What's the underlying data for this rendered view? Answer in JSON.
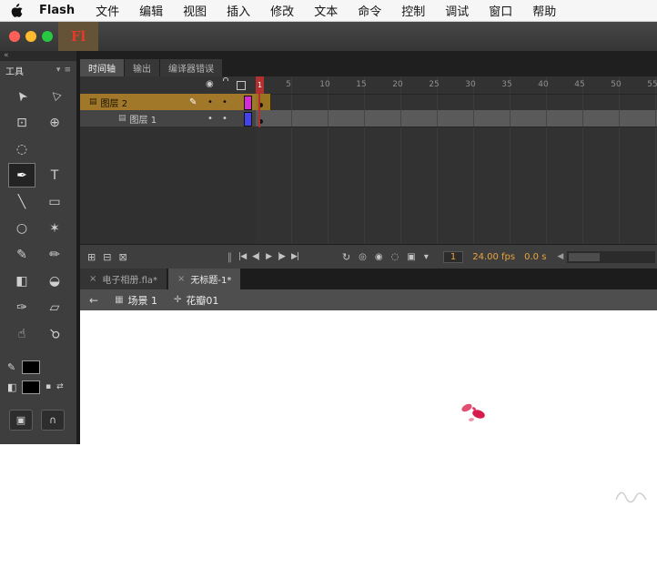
{
  "menubar": {
    "app_name": "Flash",
    "items": [
      "文件",
      "编辑",
      "视图",
      "插入",
      "修改",
      "文本",
      "命令",
      "控制",
      "调试",
      "窗口",
      "帮助"
    ]
  },
  "titlebar": {
    "logo": "Fl"
  },
  "tools_panel": {
    "collapse": "«",
    "title": "工具",
    "menu_chevron": "▾",
    "menu_lines": "≡",
    "tools": [
      {
        "name": "selection",
        "glyph": "➤"
      },
      {
        "name": "subselection",
        "glyph": "▷"
      },
      {
        "name": "free-transform",
        "glyph": "⊡"
      },
      {
        "name": "3d-rotation",
        "glyph": "⊕"
      },
      {
        "name": "lasso",
        "glyph": "◌"
      },
      {
        "name": "pen",
        "glyph": "✒"
      },
      {
        "name": "text",
        "glyph": "T"
      },
      {
        "name": "line",
        "glyph": "╲"
      },
      {
        "name": "rectangle",
        "glyph": "▭"
      },
      {
        "name": "oval",
        "glyph": "○"
      },
      {
        "name": "polystar",
        "glyph": "✶"
      },
      {
        "name": "pencil",
        "glyph": "✎"
      },
      {
        "name": "brush",
        "glyph": "✏"
      },
      {
        "name": "paint-bucket",
        "glyph": "◧"
      },
      {
        "name": "ink-bottle",
        "glyph": "◒"
      },
      {
        "name": "eyedropper",
        "glyph": "✑"
      },
      {
        "name": "eraser",
        "glyph": "▱"
      },
      {
        "name": "hand",
        "glyph": "☝"
      },
      {
        "name": "zoom",
        "glyph": "⚲"
      }
    ],
    "stroke_icon": "✎",
    "fill_icon": "◧",
    "default_colors_icon": "▪",
    "swap_icon": "⇄",
    "option_icons": {
      "object_drawing": "▣",
      "snap": "∩"
    }
  },
  "timeline": {
    "tabs": [
      {
        "label": "时间轴"
      },
      {
        "label": "输出"
      },
      {
        "label": "编译器错误"
      }
    ],
    "header_eye": "◉",
    "layer_icon": "▤",
    "pencil": "✎",
    "layer_dot": "•",
    "layers": [
      {
        "name": "图层 2",
        "color": "#d32ed3",
        "selected": true
      },
      {
        "name": "图层 1",
        "color": "#4343e8",
        "selected": false
      }
    ],
    "playhead_frame": "1",
    "ruler_numbers": [
      "5",
      "10",
      "15",
      "20",
      "25",
      "30",
      "35",
      "40",
      "45",
      "50",
      "55"
    ],
    "footer": {
      "new_layer": "⊞",
      "new_folder": "⊟",
      "delete": "⊠",
      "divider": "∥",
      "playback": [
        "|◀",
        "◀|",
        "▶",
        "|▶",
        "▶|"
      ],
      "loop": "↻",
      "onion": [
        "◎",
        "◉",
        "◌",
        "▣",
        "▾"
      ],
      "current_frame": "1",
      "fps": "24.00 fps",
      "elapsed": "0.0 s",
      "scroll_left": "◀"
    }
  },
  "documents": {
    "tabs": [
      {
        "close": "×",
        "label": "电子相册.fla*",
        "active": false
      },
      {
        "close": "×",
        "label": "无标题-1*",
        "active": true
      }
    ]
  },
  "edit_bar": {
    "back": "←",
    "scene_icon": "▦",
    "scene": "场景 1",
    "symbol_icon": "✛",
    "symbol": "花瓣01"
  },
  "colors": {
    "accent_orange": "#e8a33d",
    "selected_layer": "#a1782a",
    "playhead_red": "#b33030",
    "layer2_outline": "#d32ed3",
    "layer1_outline": "#4343e8",
    "petal": "#d81b4f",
    "stroke_swatch": "#000000",
    "fill_swatch": "#000000"
  }
}
